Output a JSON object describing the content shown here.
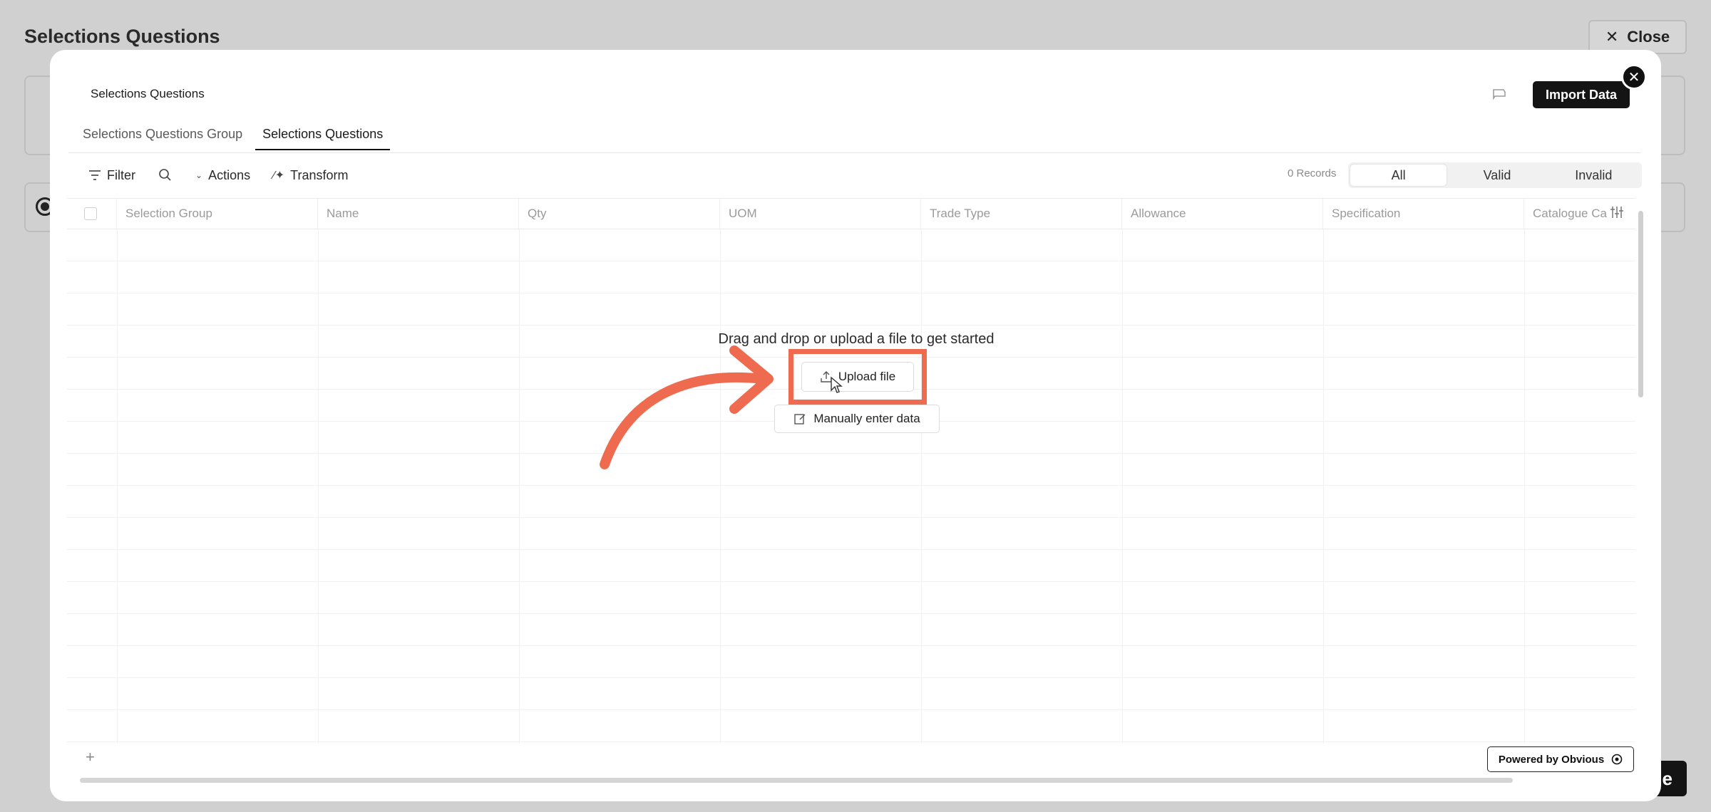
{
  "background": {
    "title": "Selections Questions",
    "close_label": "Close",
    "primary_button_partial": "e"
  },
  "modal": {
    "title": "Selections Questions",
    "import_button": "Import Data",
    "tabs": [
      {
        "label": "Selections Questions Group",
        "active": false
      },
      {
        "label": "Selections Questions",
        "active": true
      }
    ],
    "toolbar": {
      "filter": "Filter",
      "actions": "Actions",
      "transform": "Transform"
    },
    "records": "0 Records",
    "segments": [
      "All",
      "Valid",
      "Invalid"
    ],
    "columns": [
      "Selection Group",
      "Name",
      "Qty",
      "UOM",
      "Trade Type",
      "Allowance",
      "Specification",
      "Catalogue Ca"
    ],
    "empty_state": {
      "message": "Drag and drop or upload a file to get started",
      "upload_label": "Upload file",
      "manual_label": "Manually enter data"
    },
    "add_row": "+",
    "powered_by": "Powered by Obvious"
  },
  "colors": {
    "highlight": "#ee6b50",
    "dark_button": "#141414"
  }
}
